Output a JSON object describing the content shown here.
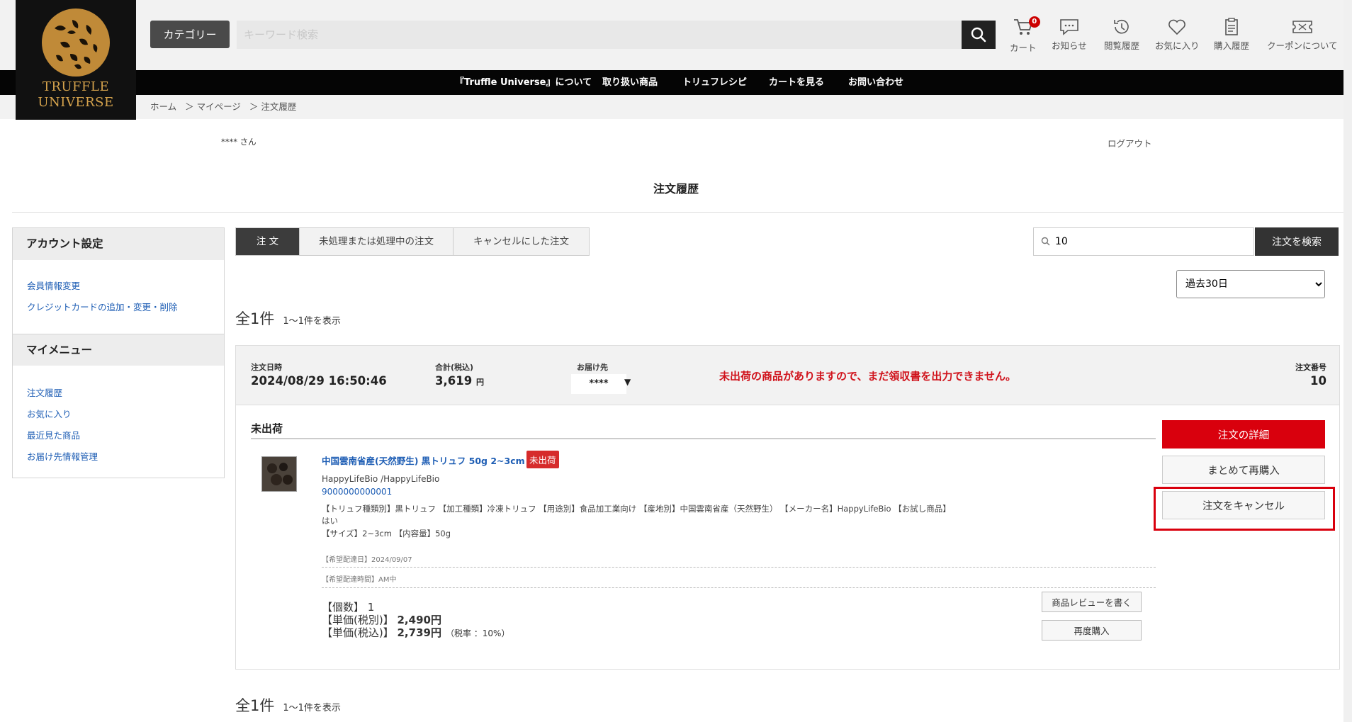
{
  "brand": {
    "line1": "TRUFFLE",
    "line2": "UNIVERSE"
  },
  "header": {
    "category_label": "カテゴリー",
    "search_placeholder": "キーワード検索",
    "icons": [
      {
        "name": "cart",
        "label": "カート",
        "badge": "0"
      },
      {
        "name": "news",
        "label": "お知らせ"
      },
      {
        "name": "history",
        "label": "閲覧履歴"
      },
      {
        "name": "favorite",
        "label": "お気に入り"
      },
      {
        "name": "purchase",
        "label": "購入履歴"
      },
      {
        "name": "coupon",
        "label": "クーポンについて"
      }
    ]
  },
  "nav": [
    "『Truffle Universe』について",
    "取り扱い商品",
    "トリュフレシピ",
    "カートを見る",
    "お問い合わせ"
  ],
  "breadcrumb": [
    "ホーム",
    "＞ マイページ",
    "＞ 注文履歴"
  ],
  "user": {
    "name": "**** さん",
    "logout": "ログアウト"
  },
  "page_title": "注文履歴",
  "sidebar": {
    "account_heading": "アカウント設定",
    "account_links": [
      "会員情報変更",
      "クレジットカードの追加・変更・削除"
    ],
    "menu_heading": "マイメニュー",
    "menu_links": [
      "注文履歴",
      "お気に入り",
      "最近見た商品",
      "お届け先情報管理"
    ]
  },
  "tabs": [
    "注 文",
    "未処理または処理中の注文",
    "キャンセルにした注文"
  ],
  "order_search": {
    "value": "10",
    "button": "注文を検索"
  },
  "period": {
    "selected": "過去30日"
  },
  "count": {
    "total": "全1件",
    "range": "1〜1件を表示"
  },
  "order": {
    "date_label": "注文日時",
    "date": "2024/08/29 16:50:46",
    "total_label": "合計(税込)",
    "total": "3,619",
    "total_unit": "円",
    "dest_label": "お届け先",
    "dest": "****",
    "warning": "未出荷の商品がありますので、まだ領収書を出力できません。",
    "no_label": "注文番号",
    "no": "10",
    "ship_status": "未出荷",
    "product": {
      "name": "中国雲南省産(天然野生) 黒トリュフ 50g 2~3cm",
      "badge": "未出荷",
      "maker": "HappyLifeBio /HappyLifeBio",
      "code": "9000000000001",
      "attrs1": "【トリュフ種類別】黒トリュフ 【加工種類】冷凍トリュフ 【用途別】食品加工業向け 【産地別】中国雲南省産（天然野生） 【メーカー名】HappyLifeBio 【お試し商品】",
      "attrs1b": "はい",
      "attrs2": "【サイズ】2~3cm 【内容量】50g",
      "delivery_date": "【希望配達日】2024/09/07",
      "delivery_time": "【希望配達時間】AM中",
      "qty": "【個数】 1",
      "unit_ex_label": "【単価(税別)】",
      "unit_ex": "2,490円",
      "unit_in_label": "【単価(税込)】",
      "unit_in": "2,739円",
      "tax": "（税率 ：10%）",
      "review_btn": "商品レビューを書く",
      "rebuy_btn": "再度購入"
    },
    "detail_btn": "注文の詳細",
    "rebuy_all_btn": "まとめて再購入",
    "cancel_btn": "注文をキャンセル"
  },
  "colors": {
    "accent_red": "#d9000d",
    "link_blue": "#1d5db4",
    "nav_bg": "#050505"
  }
}
